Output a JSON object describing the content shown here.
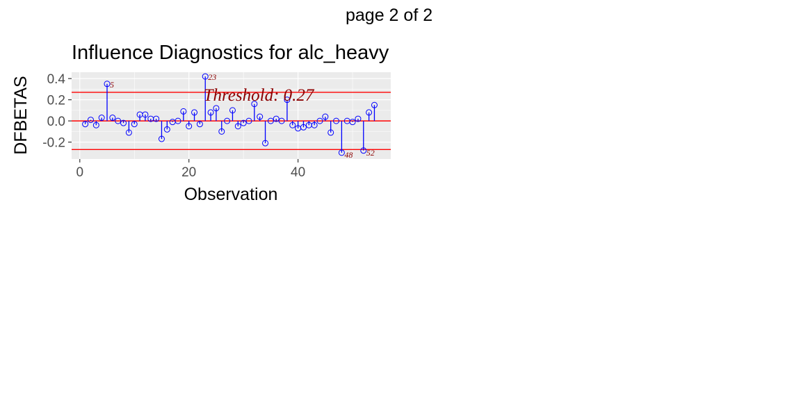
{
  "page_label": "page 2 of 2",
  "chart_data": {
    "type": "scatter",
    "title": "Influence Diagnostics for alc_heavy",
    "xlabel": "Observation",
    "ylabel": "DFBETAS",
    "xlim": [
      -1.5,
      57
    ],
    "ylim": [
      -0.36,
      0.46
    ],
    "x_ticks": [
      0,
      20,
      40
    ],
    "x_tick_labels": [
      "0",
      "20",
      "40"
    ],
    "y_ticks": [
      -0.2,
      0.0,
      0.2,
      0.4
    ],
    "y_tick_labels": [
      "-0.2",
      "0.0",
      "0.2",
      "0.4"
    ],
    "grid": true,
    "threshold": 0.27,
    "threshold_label": "Threshold: 0.27",
    "colors": {
      "panel_bg": "#ebebeb",
      "grid": "#ffffff",
      "point": "#0000ff",
      "threshold_line": "#ff0000",
      "annotation": "#8b0000"
    },
    "observations": [
      1,
      2,
      3,
      4,
      5,
      6,
      7,
      8,
      9,
      10,
      11,
      12,
      13,
      14,
      15,
      16,
      17,
      18,
      19,
      20,
      21,
      22,
      23,
      24,
      25,
      26,
      27,
      28,
      29,
      30,
      31,
      32,
      33,
      34,
      35,
      36,
      37,
      38,
      39,
      40,
      41,
      42,
      43,
      44,
      45,
      46,
      47,
      48,
      49,
      50,
      51,
      52,
      53,
      54
    ],
    "dfbetas": [
      -0.03,
      0.01,
      -0.04,
      0.03,
      0.35,
      0.03,
      0.0,
      -0.02,
      -0.11,
      -0.03,
      0.06,
      0.06,
      0.02,
      0.02,
      -0.17,
      -0.08,
      -0.01,
      0.0,
      0.09,
      -0.05,
      0.08,
      -0.03,
      0.42,
      0.08,
      0.12,
      -0.1,
      0.0,
      0.1,
      -0.05,
      -0.02,
      0.0,
      0.16,
      0.04,
      -0.21,
      0.0,
      0.02,
      0.0,
      0.2,
      -0.04,
      -0.07,
      -0.06,
      -0.04,
      -0.04,
      0.0,
      0.04,
      -0.11,
      0.0,
      -0.3,
      0.0,
      -0.01,
      0.02,
      -0.28,
      0.08,
      0.15
    ],
    "labeled_points": [
      {
        "x": 5,
        "label": "5"
      },
      {
        "x": 23,
        "label": "23"
      },
      {
        "x": 48,
        "label": "48"
      },
      {
        "x": 52,
        "label": "52"
      }
    ]
  }
}
